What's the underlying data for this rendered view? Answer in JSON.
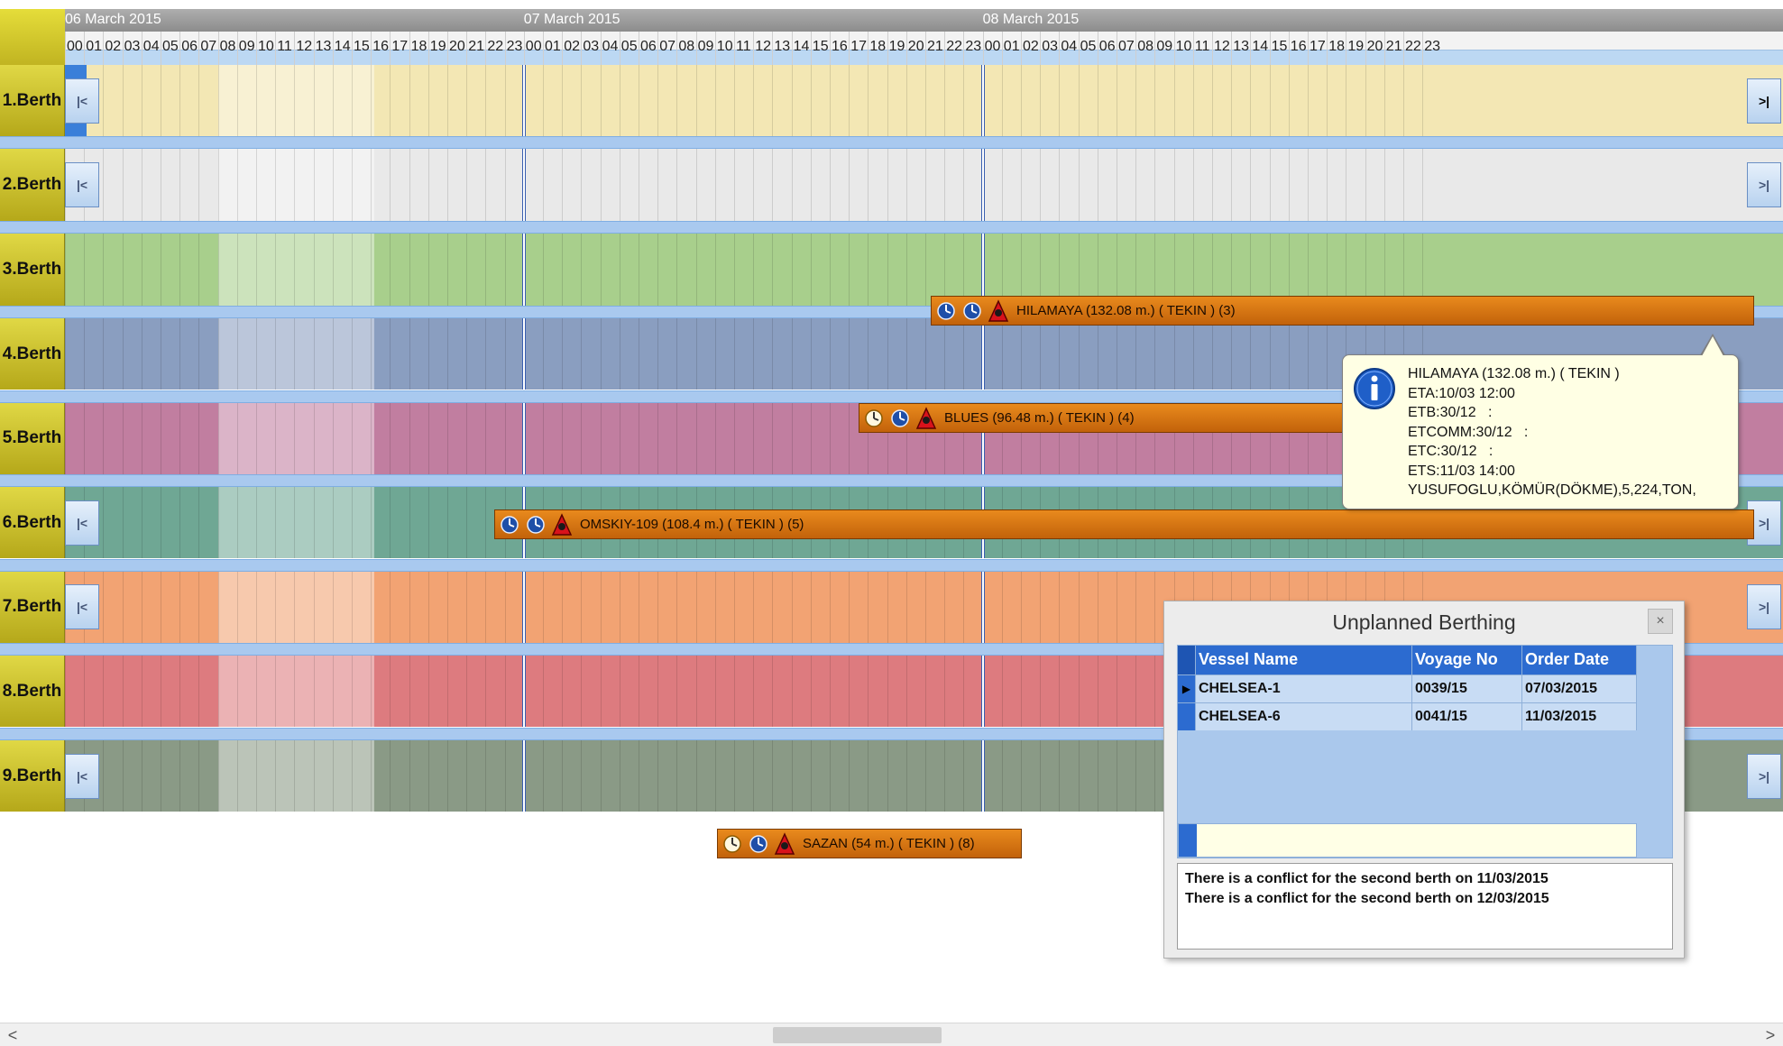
{
  "timeline": {
    "dates": [
      {
        "label": "06 March 2015"
      },
      {
        "label": "07 March 2015"
      },
      {
        "label": "08 March 2015"
      }
    ],
    "hours": [
      "00",
      "01",
      "02",
      "03",
      "04",
      "05",
      "06",
      "07",
      "08",
      "09",
      "10",
      "11",
      "12",
      "13",
      "14",
      "15",
      "16",
      "17",
      "18",
      "19",
      "20",
      "21",
      "22",
      "23"
    ]
  },
  "berths": [
    {
      "label": "1.Berth",
      "color": "#f3e7b4",
      "nav_left": "|<",
      "nav_right": ">|"
    },
    {
      "label": "2.Berth",
      "color": "#e9e9e9",
      "nav_left": "|<",
      "nav_right": ">|"
    },
    {
      "label": "3.Berth",
      "color": "#a8cf8c",
      "nav_left": "",
      "nav_right": ""
    },
    {
      "label": "4.Berth",
      "color": "#8a9ec0",
      "nav_left": "",
      "nav_right": ""
    },
    {
      "label": "5.Berth",
      "color": "#c17ea0",
      "nav_left": "",
      "nav_right": ""
    },
    {
      "label": "6.Berth",
      "color": "#6fa794",
      "nav_left": "|<",
      "nav_right": ">|"
    },
    {
      "label": "7.Berth",
      "color": "#f2a373",
      "nav_left": "|<",
      "nav_right": ">|"
    },
    {
      "label": "8.Berth",
      "color": "#dd7b7f",
      "nav_left": "",
      "nav_right": ""
    },
    {
      "label": "9.Berth",
      "color": "#8a9a86",
      "nav_left": "|<",
      "nav_right": ">|"
    }
  ],
  "vessels": [
    {
      "berth": 3,
      "label": "HILAMAYA (132.08 m.) ( TEKIN ) (3)",
      "icons": [
        "clock-blue-icon",
        "clock-blue-icon",
        "alert-bell-icon"
      ]
    },
    {
      "berth": 4,
      "label": "BLUES (96.48 m.) ( TEKIN ) (4)",
      "icons": [
        "clock-white-icon",
        "clock-blue-icon",
        "alert-bell-icon"
      ]
    },
    {
      "berth": 5,
      "label": "OMSKIY-109 (108.4 m.) ( TEKIN ) (5)",
      "icons": [
        "clock-blue-icon",
        "clock-blue-icon",
        "alert-bell-icon"
      ]
    },
    {
      "berth": 8,
      "label": "SAZAN (54 m.) ( TEKIN ) (8)",
      "icons": [
        "clock-white-icon",
        "clock-blue-icon",
        "alert-bell-icon"
      ]
    }
  ],
  "tooltip": {
    "icon": "info-icon",
    "lines": [
      "HILAMAYA (132.08 m.) ( TEKIN )",
      "ETA:10/03 12:00",
      "ETB:30/12   :",
      "ETCOMM:30/12   :",
      "ETC:30/12   :",
      "ETS:11/03 14:00",
      "YUSUFOGLU,KÖMÜR(DÖKME),5,224,TON,"
    ]
  },
  "dialog": {
    "title": "Unplanned Berthing",
    "close_label": "×",
    "columns": [
      "Vessel Name",
      "Voyage No",
      "Order Date"
    ],
    "rows": [
      {
        "vessel": "CHELSEA-1",
        "voyage": "0039/15",
        "order_date": "07/03/2015",
        "current": true
      },
      {
        "vessel": "CHELSEA-6",
        "voyage": "0041/15",
        "order_date": "11/03/2015",
        "current": false
      }
    ],
    "messages": [
      "There is a conflict for the second berth on 11/03/2015",
      "There is a conflict for the second berth on 12/03/2015"
    ]
  },
  "scrollbar": {
    "left_arrow": "<",
    "right_arrow": ">"
  }
}
